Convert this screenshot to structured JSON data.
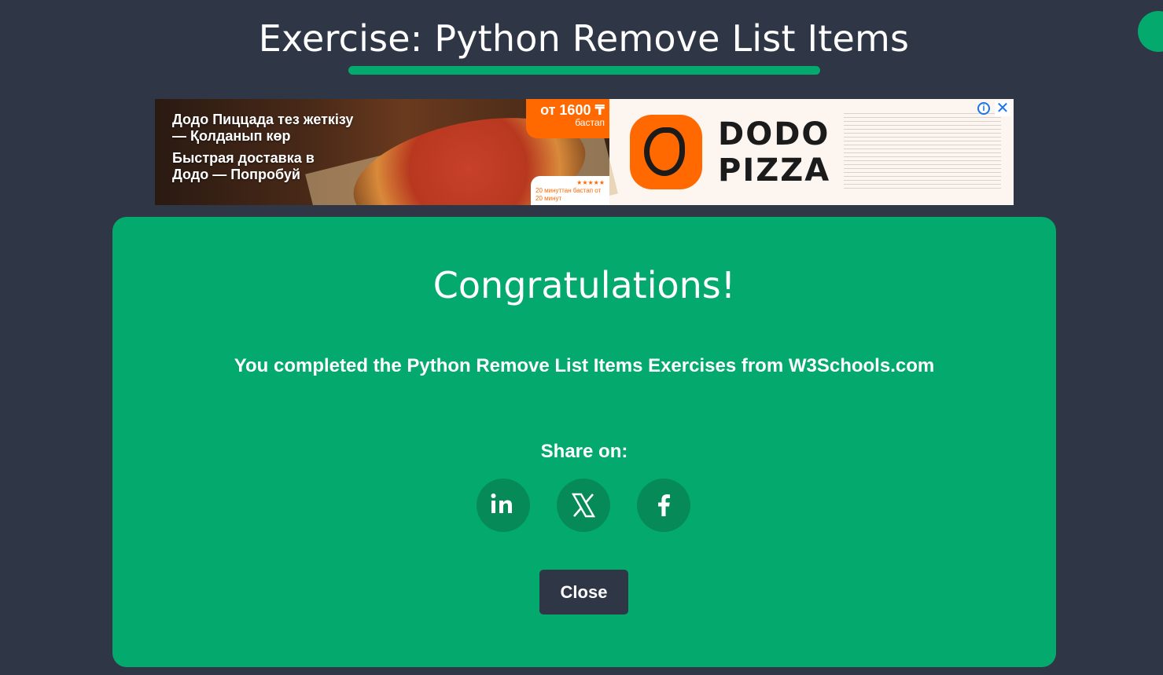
{
  "page": {
    "title": "Exercise: Python Remove List Items"
  },
  "ad": {
    "headline_kz": "Додо Пиццада тез жеткізу — Қолданып көр",
    "headline_ru": "Быстрая доставка в Додо — Попробуй",
    "price": "от 1600 ₸",
    "price_note": "бастап",
    "rating_note": "20 минуттан бастап от 20 минут",
    "brand": "DODO PIZZA",
    "info_icon": "info-icon",
    "close_icon": "close-icon",
    "brand_color": "#ff6900"
  },
  "modal": {
    "heading": "Congratulations!",
    "message": "You completed the Python Remove List Items Exercises from W3Schools.com",
    "share_label": "Share on:",
    "share_buttons": [
      {
        "icon": "linkedin-icon",
        "label": "in"
      },
      {
        "icon": "x-icon",
        "label": "X"
      },
      {
        "icon": "facebook-icon",
        "label": "f"
      }
    ],
    "close_label": "Close",
    "accent_color": "#04aa6d",
    "background_color": "#2f3646"
  }
}
